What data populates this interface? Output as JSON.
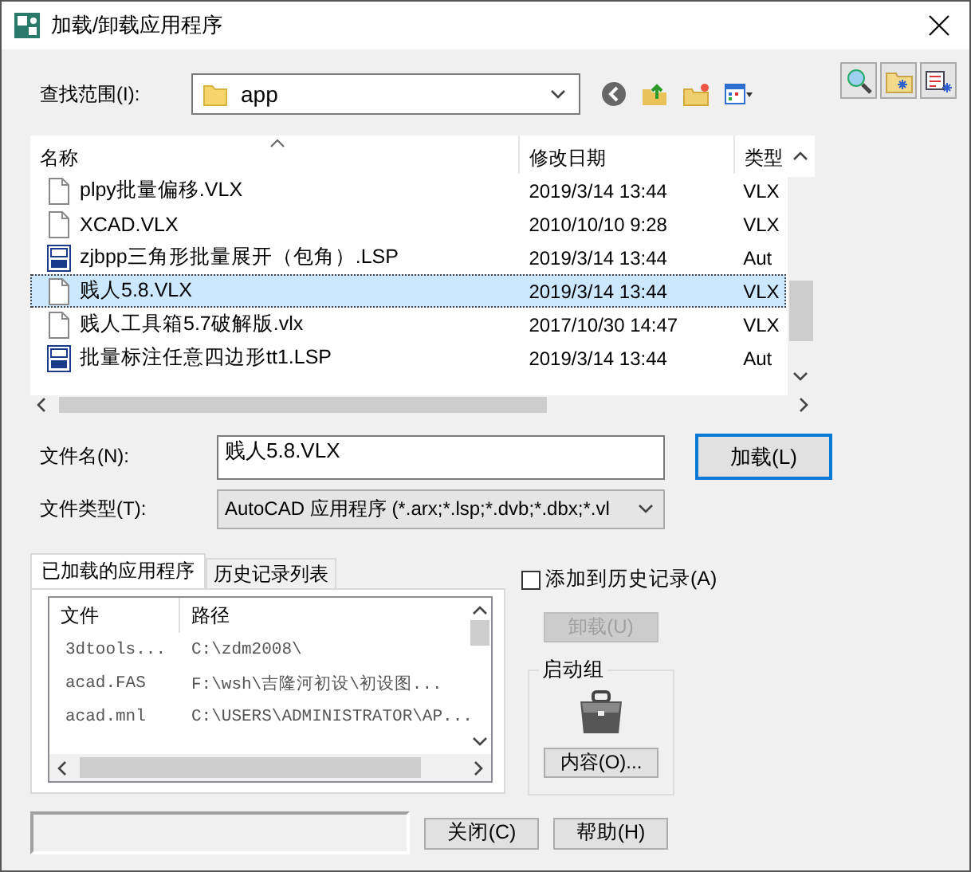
{
  "window": {
    "title": "加载/卸载应用程序"
  },
  "look_in": {
    "label": "查找范围(I):",
    "value": "app"
  },
  "file_list": {
    "columns": [
      "名称",
      "修改日期",
      "类型"
    ],
    "rows": [
      {
        "name": "plpy批量偏移.VLX",
        "date": "2019/3/14 13:44",
        "type": "VLX",
        "kind": "vlx",
        "selected": false
      },
      {
        "name": "XCAD.VLX",
        "date": "2010/10/10 9:28",
        "type": "VLX",
        "kind": "vlx",
        "selected": false
      },
      {
        "name": "zjbpp三角形批量展开（包角）.LSP",
        "date": "2019/3/14 13:44",
        "type": "Aut",
        "kind": "lsp",
        "selected": false
      },
      {
        "name": "贱人5.8.VLX",
        "date": "2019/3/14 13:44",
        "type": "VLX",
        "kind": "vlx",
        "selected": true
      },
      {
        "name": "贱人工具箱5.7破解版.vlx",
        "date": "2017/10/30 14:47",
        "type": "VLX",
        "kind": "vlx",
        "selected": false
      },
      {
        "name": "批量标注任意四边形tt1.LSP",
        "date": "2019/3/14 13:44",
        "type": "Aut",
        "kind": "lsp",
        "selected": false
      }
    ]
  },
  "file_name": {
    "label": "文件名(N):",
    "value": "贱人5.8.VLX"
  },
  "file_type": {
    "label": "文件类型(T):",
    "value": "AutoCAD 应用程序 (*.arx;*.lsp;*.dvb;*.dbx;*.vl"
  },
  "load_button": "加载(L)",
  "tabs": [
    {
      "label": "已加载的应用程序",
      "selected": true
    },
    {
      "label": "历史记录列表",
      "selected": false
    }
  ],
  "loaded_apps": {
    "columns": [
      "文件",
      "路径"
    ],
    "rows": [
      {
        "file": "3dtools...",
        "path": "C:\\zdm2008\\"
      },
      {
        "file": "acad.FAS",
        "path": "F:\\wsh\\吉隆河初设\\初设图..."
      },
      {
        "file": "acad.mnl",
        "path": "C:\\USERS\\ADMINISTRATOR\\AP..."
      }
    ]
  },
  "add_to_history": {
    "label": "添加到历史记录(A)",
    "checked": false
  },
  "unload_button": {
    "label": "卸载(U)",
    "disabled": true
  },
  "startup_suite": {
    "title": "启动组",
    "button": "内容(O)..."
  },
  "buttons": [
    "关闭(C)",
    "帮助(H)"
  ]
}
